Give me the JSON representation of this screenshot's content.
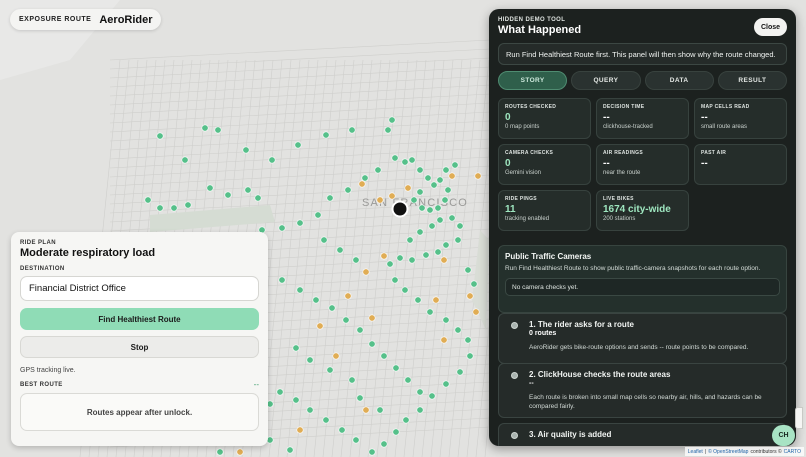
{
  "map": {
    "city_label": "SAN FRANCISCO",
    "colors": {
      "green_pin": "#56c08a",
      "amber_pin": "#e0ad55",
      "rider": "#111111"
    }
  },
  "exposure": {
    "label": "EXPOSURE ROUTE",
    "brand": "AeroRider"
  },
  "ride": {
    "eyebrow": "RIDE PLAN",
    "title": "Moderate respiratory load",
    "destination_label": "DESTINATION",
    "destination_value": "Financial District Office",
    "find_button": "Find Healthiest Route",
    "stop_button": "Stop",
    "gps_status": "GPS tracking live.",
    "best_route_label": "BEST ROUTE",
    "best_route_value": "--",
    "routes_placeholder": "Routes appear after unlock."
  },
  "panel": {
    "eyebrow": "HIDDEN DEMO TOOL",
    "title": "What Happened",
    "close_label": "Close",
    "notice": "Run Find Healthiest Route first. This panel will then show why the route changed.",
    "tabs": [
      {
        "label": "STORY",
        "active": true
      },
      {
        "label": "QUERY",
        "active": false
      },
      {
        "label": "DATA",
        "active": false
      },
      {
        "label": "RESULT",
        "active": false
      }
    ],
    "metrics": [
      {
        "label": "ROUTES CHECKED",
        "value": "0",
        "sub": "0 map points"
      },
      {
        "label": "DECISION TIME",
        "value": "--",
        "sub": "clickhouse-tracked"
      },
      {
        "label": "MAP CELLS READ",
        "value": "--",
        "sub": "small route areas"
      },
      {
        "label": "CAMERA CHECKS",
        "value": "0",
        "sub": "Gemini vision"
      },
      {
        "label": "AIR READINGS",
        "value": "--",
        "sub": "near the route"
      },
      {
        "label": "PAST AIR",
        "value": "--",
        "sub": ""
      },
      {
        "label": "RIDE PINGS",
        "value": "11",
        "sub": "tracking enabled"
      },
      {
        "label": "LIVE BIKES",
        "value": "1674 city-wide",
        "sub": "200 stations"
      }
    ],
    "cameras": {
      "title": "Public Traffic Cameras",
      "body": "Run Find Healthiest Route to show public traffic-camera snapshots for each route option.",
      "empty": "No camera checks yet."
    },
    "steps": [
      {
        "title": "1. The rider asks for a route",
        "count": "0 routes",
        "desc": "AeroRider gets bike-route options and sends -- route points to be compared."
      },
      {
        "title": "2. ClickHouse checks the route areas",
        "count": "--",
        "desc": "Each route is broken into small map cells so nearby air, hills, and hazards can be compared fairly."
      },
      {
        "title": "3. Air quality is added",
        "count": "",
        "desc": ""
      }
    ]
  },
  "badge": {
    "initials": "CH"
  },
  "attribution": {
    "leaflet": "Leaflet",
    "osm": "© OpenStreetMap",
    "contrib": "contributors ©",
    "carto": "CARTO"
  }
}
